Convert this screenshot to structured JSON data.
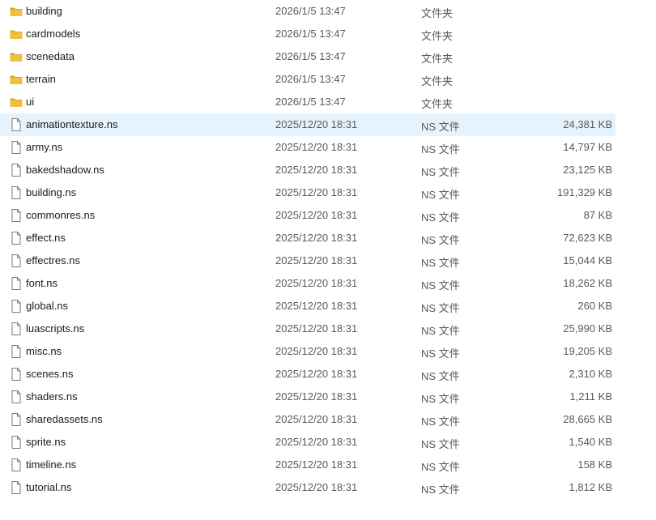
{
  "colors": {
    "folder": "#f0c040",
    "folder_dark": "#dba72a",
    "file_outline": "#7a7a7a",
    "selected_row": "#e5f3ff"
  },
  "rows": [
    {
      "name": "building",
      "date": "2026/1/5 13:47",
      "type": "文件夹",
      "size": "",
      "icon": "folder-icon"
    },
    {
      "name": "cardmodels",
      "date": "2026/1/5 13:47",
      "type": "文件夹",
      "size": "",
      "icon": "folder-icon"
    },
    {
      "name": "scenedata",
      "date": "2026/1/5 13:47",
      "type": "文件夹",
      "size": "",
      "icon": "folder-icon"
    },
    {
      "name": "terrain",
      "date": "2026/1/5 13:47",
      "type": "文件夹",
      "size": "",
      "icon": "folder-icon"
    },
    {
      "name": "ui",
      "date": "2026/1/5 13:47",
      "type": "文件夹",
      "size": "",
      "icon": "folder-icon"
    },
    {
      "name": "animationtexture.ns",
      "date": "2025/12/20 18:31",
      "type": "NS 文件",
      "size": "24,381 KB",
      "icon": "file-icon",
      "selected": true
    },
    {
      "name": "army.ns",
      "date": "2025/12/20 18:31",
      "type": "NS 文件",
      "size": "14,797 KB",
      "icon": "file-icon"
    },
    {
      "name": "bakedshadow.ns",
      "date": "2025/12/20 18:31",
      "type": "NS 文件",
      "size": "23,125 KB",
      "icon": "file-icon"
    },
    {
      "name": "building.ns",
      "date": "2025/12/20 18:31",
      "type": "NS 文件",
      "size": "191,329 KB",
      "icon": "file-icon"
    },
    {
      "name": "commonres.ns",
      "date": "2025/12/20 18:31",
      "type": "NS 文件",
      "size": "87 KB",
      "icon": "file-icon"
    },
    {
      "name": "effect.ns",
      "date": "2025/12/20 18:31",
      "type": "NS 文件",
      "size": "72,623 KB",
      "icon": "file-icon"
    },
    {
      "name": "effectres.ns",
      "date": "2025/12/20 18:31",
      "type": "NS 文件",
      "size": "15,044 KB",
      "icon": "file-icon"
    },
    {
      "name": "font.ns",
      "date": "2025/12/20 18:31",
      "type": "NS 文件",
      "size": "18,262 KB",
      "icon": "file-icon"
    },
    {
      "name": "global.ns",
      "date": "2025/12/20 18:31",
      "type": "NS 文件",
      "size": "260 KB",
      "icon": "file-icon"
    },
    {
      "name": "luascripts.ns",
      "date": "2025/12/20 18:31",
      "type": "NS 文件",
      "size": "25,990 KB",
      "icon": "file-icon"
    },
    {
      "name": "misc.ns",
      "date": "2025/12/20 18:31",
      "type": "NS 文件",
      "size": "19,205 KB",
      "icon": "file-icon"
    },
    {
      "name": "scenes.ns",
      "date": "2025/12/20 18:31",
      "type": "NS 文件",
      "size": "2,310 KB",
      "icon": "file-icon"
    },
    {
      "name": "shaders.ns",
      "date": "2025/12/20 18:31",
      "type": "NS 文件",
      "size": "1,211 KB",
      "icon": "file-icon"
    },
    {
      "name": "sharedassets.ns",
      "date": "2025/12/20 18:31",
      "type": "NS 文件",
      "size": "28,665 KB",
      "icon": "file-icon"
    },
    {
      "name": "sprite.ns",
      "date": "2025/12/20 18:31",
      "type": "NS 文件",
      "size": "1,540 KB",
      "icon": "file-icon"
    },
    {
      "name": "timeline.ns",
      "date": "2025/12/20 18:31",
      "type": "NS 文件",
      "size": "158 KB",
      "icon": "file-icon"
    },
    {
      "name": "tutorial.ns",
      "date": "2025/12/20 18:31",
      "type": "NS 文件",
      "size": "1,812 KB",
      "icon": "file-icon"
    }
  ]
}
